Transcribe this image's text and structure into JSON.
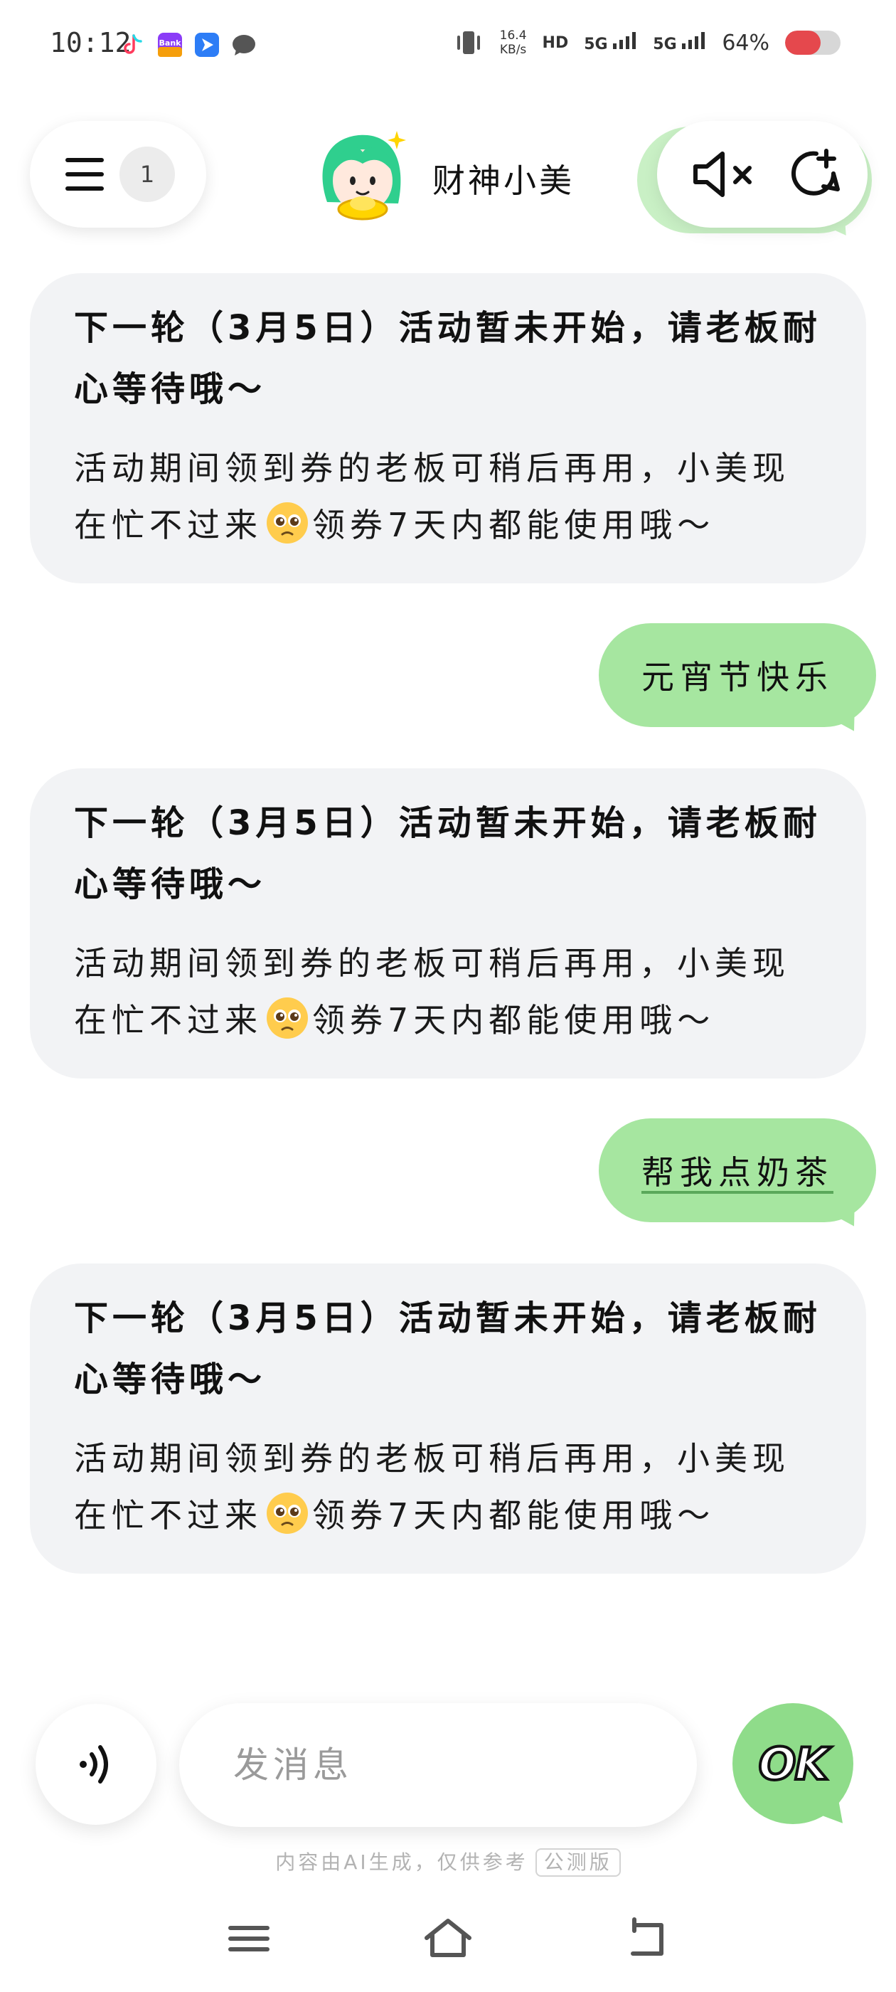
{
  "status_bar": {
    "time": "10:12",
    "net_speed_value": "16.4",
    "net_speed_unit": "KB/s",
    "hd_label": "HD",
    "sim1": "5G",
    "sim2": "5G",
    "battery_percent": "64%",
    "battery_level": 0.64,
    "battery_color": "#e5484d"
  },
  "header": {
    "menu_badge": "1",
    "bot_name": "财神小美"
  },
  "messages": [
    {
      "role": "bot",
      "title": "下一轮（3月5日）活动暂未开始，请老板耐心等待哦～",
      "body_before_emoji": "活动期间领到券的老板可稍后再用，小美现在忙不过来",
      "emoji": "pleading-face",
      "body_after_emoji": "领券7天内都能使用哦～"
    },
    {
      "role": "user",
      "text": "元宵节快乐"
    },
    {
      "role": "bot",
      "title": "下一轮（3月5日）活动暂未开始，请老板耐心等待哦～",
      "body_before_emoji": "活动期间领到券的老板可稍后再用，小美现在忙不过来",
      "emoji": "pleading-face",
      "body_after_emoji": "领券7天内都能使用哦～"
    },
    {
      "role": "user",
      "text": "帮我点奶茶"
    },
    {
      "role": "bot",
      "title": "下一轮（3月5日）活动暂未开始，请老板耐心等待哦～",
      "body_before_emoji": "活动期间领到券的老板可稍后再用，小美现在忙不过来",
      "emoji": "pleading-face",
      "body_after_emoji": "领券7天内都能使用哦～"
    }
  ],
  "input_bar": {
    "placeholder": "发消息",
    "send_label": "OK"
  },
  "footer": {
    "disclaimer": "内容由AI生成，仅供参考",
    "beta_tag": "公测版"
  },
  "colors": {
    "accent_green": "#8fdc8a",
    "user_bubble": "#a6e6a0",
    "bot_bubble": "#f2f3f5"
  }
}
